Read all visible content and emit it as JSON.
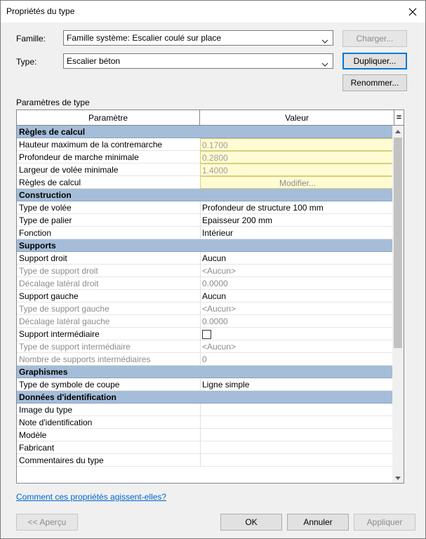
{
  "window": {
    "title": "Propriétés du type"
  },
  "famille": {
    "label": "Famille:",
    "value": "Famille système: Escalier coulé sur place"
  },
  "type": {
    "label": "Type:",
    "value": "Escalier béton"
  },
  "buttons": {
    "charger": "Charger...",
    "dupliquer": "Dupliquer...",
    "renommer": "Renommer...",
    "apercu": "<< Aperçu",
    "ok": "OK",
    "annuler": "Annuler",
    "appliquer": "Appliquer"
  },
  "params_title": "Paramètres de type",
  "table": {
    "col_param": "Paramètre",
    "col_value": "Valeur",
    "col_eq": "="
  },
  "groups": [
    {
      "name": "Règles de calcul",
      "rows": [
        {
          "param": "Hauteur maximum de la contremarche",
          "value": "0.1700",
          "style": "yellow"
        },
        {
          "param": "Profondeur de marche minimale",
          "value": "0.2800",
          "style": "yellow"
        },
        {
          "param": "Largeur de volée minimale",
          "value": "1.4000",
          "style": "yellow"
        },
        {
          "param": "Règles de calcul",
          "value": "Modifier...",
          "style": "button"
        }
      ]
    },
    {
      "name": "Construction",
      "rows": [
        {
          "param": "Type de volée",
          "value": "Profondeur de structure 100 mm"
        },
        {
          "param": "Type de palier",
          "value": "Epaisseur 200 mm"
        },
        {
          "param": "Fonction",
          "value": "Intérieur"
        }
      ]
    },
    {
      "name": "Supports",
      "rows": [
        {
          "param": "Support droit",
          "value": "Aucun"
        },
        {
          "param": "Type de support droit",
          "value": "<Aucun>",
          "style": "dim"
        },
        {
          "param": "Décalage latéral droit",
          "value": "0.0000",
          "style": "dim"
        },
        {
          "param": "Support gauche",
          "value": "Aucun"
        },
        {
          "param": "Type de support gauche",
          "value": "<Aucun>",
          "style": "dim"
        },
        {
          "param": "Décalage latéral gauche",
          "value": "0.0000",
          "style": "dim"
        },
        {
          "param": "Support intermédiaire",
          "value": "",
          "style": "checkbox"
        },
        {
          "param": "Type de support intermédiaire",
          "value": "<Aucun>",
          "style": "dim"
        },
        {
          "param": "Nombre de supports intermédiaires",
          "value": "0",
          "style": "dim"
        }
      ]
    },
    {
      "name": "Graphismes",
      "rows": [
        {
          "param": "Type de symbole de coupe",
          "value": "Ligne simple"
        }
      ]
    },
    {
      "name": "Données d'identification",
      "rows": [
        {
          "param": "Image du type",
          "value": ""
        },
        {
          "param": "Note d'identification",
          "value": ""
        },
        {
          "param": "Modèle",
          "value": ""
        },
        {
          "param": "Fabricant",
          "value": ""
        },
        {
          "param": "Commentaires du type",
          "value": ""
        }
      ]
    }
  ],
  "help_link": "Comment ces propriétés agissent-elles?",
  "icons": {
    "close": "close-icon",
    "chevron": "chevron-down-icon",
    "collapse": "double-chevron-up-icon"
  }
}
